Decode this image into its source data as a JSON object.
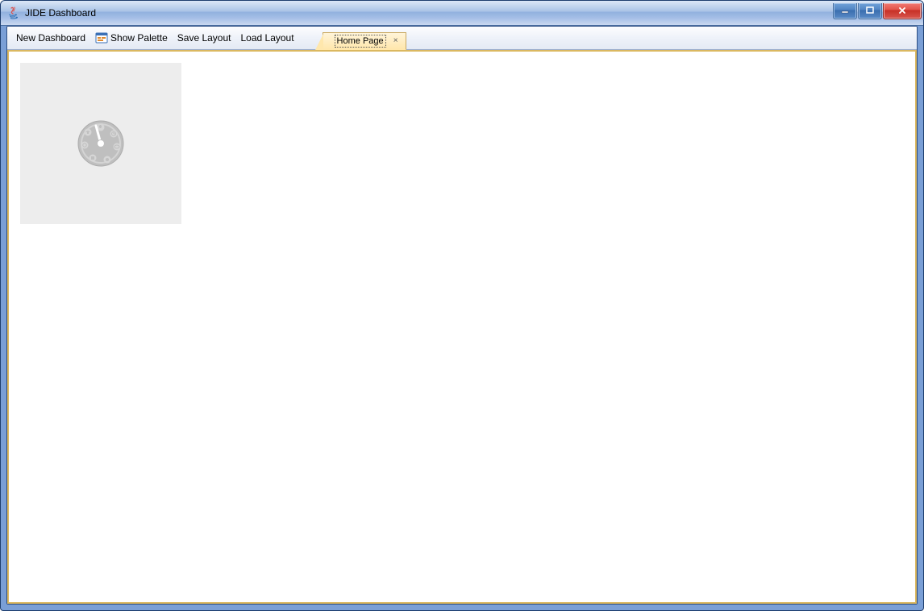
{
  "window": {
    "title": "JIDE Dashboard"
  },
  "toolbar": {
    "new_dashboard": "New Dashboard",
    "show_palette": "Show Palette",
    "save_layout": "Save Layout",
    "load_layout": "Load Layout"
  },
  "tabs": {
    "home": {
      "label": "Home Page",
      "close_glyph": "×"
    }
  }
}
